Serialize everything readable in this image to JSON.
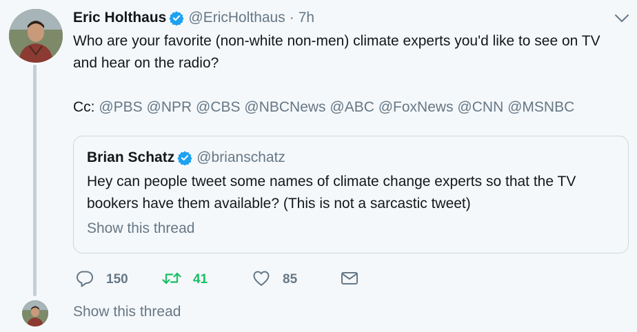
{
  "tweet": {
    "author_name": "Eric Holthaus",
    "author_handle": "@EricHolthaus",
    "separator": "·",
    "time": "7h",
    "text_line1": "Who are your favorite (non-white non-men) climate experts you'd like to see on TV and hear on the radio?",
    "cc_label": "Cc:",
    "mentions": [
      "@PBS",
      "@NPR",
      "@CBS",
      "@NBCNews",
      "@ABC",
      "@FoxNews",
      "@CNN",
      "@MSNBC"
    ]
  },
  "quote": {
    "author_name": "Brian Schatz",
    "author_handle": "@brianschatz",
    "text": "Hey can people tweet some names of climate change experts so that the TV bookers have them available? (This is not a sarcastic tweet)",
    "show_thread": "Show this thread"
  },
  "actions": {
    "replies": "150",
    "retweets": "41",
    "likes": "85"
  },
  "footer": {
    "show_thread": "Show this thread"
  },
  "colors": {
    "verified": "#1da1f2",
    "retweet_active": "#17bf63",
    "muted": "#657786"
  }
}
